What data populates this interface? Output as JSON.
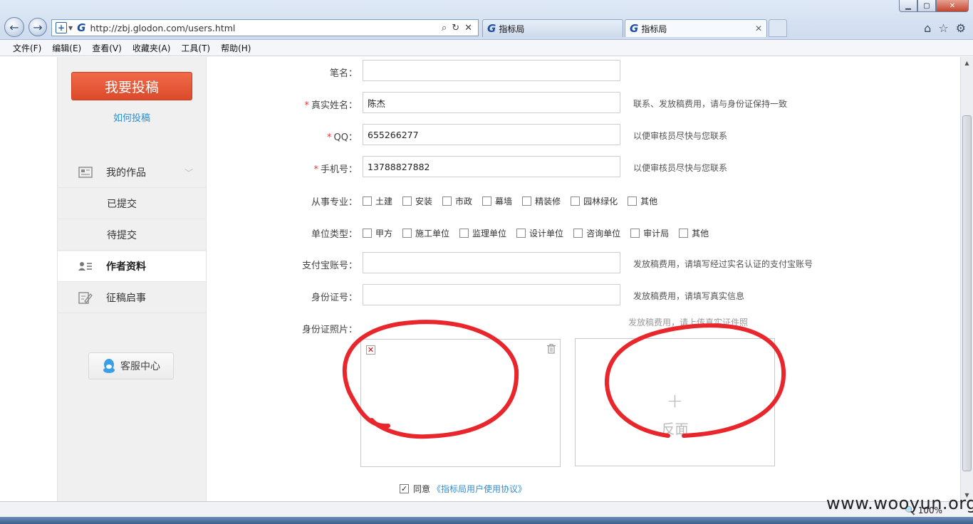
{
  "browser": {
    "url": "http://zbj.glodon.com/users.html",
    "tabs": [
      {
        "title": "指标局"
      },
      {
        "title": "指标局"
      }
    ],
    "menu": [
      "文件(F)",
      "编辑(E)",
      "查看(V)",
      "收藏夹(A)",
      "工具(T)",
      "帮助(H)"
    ],
    "zoom": "100%",
    "logo_letter": "G"
  },
  "sidebar": {
    "submit_button": "我要投稿",
    "howto_link": "如何投稿",
    "items": [
      {
        "label": "我的作品",
        "icon": "document-list-icon"
      },
      {
        "label": "已提交"
      },
      {
        "label": "待提交"
      },
      {
        "label": "作者资料",
        "icon": "profile-card-icon",
        "active": true
      },
      {
        "label": "征稿启事",
        "icon": "edit-note-icon"
      }
    ],
    "service_button": "客服中心"
  },
  "form": {
    "pen_name": {
      "label": "笔名：",
      "value": ""
    },
    "real_name": {
      "label": "真实姓名：",
      "value": "陈杰",
      "hint": "联系、发放稿费用，请与身份证保持一致",
      "required": true
    },
    "qq": {
      "label": "QQ：",
      "value": "655266277",
      "hint": "以便审核员尽快与您联系",
      "required": true
    },
    "phone": {
      "label": "手机号：",
      "value": "13788827882",
      "hint": "以便审核员尽快与您联系",
      "required": true
    },
    "profession": {
      "label": "从事专业：",
      "options": [
        "土建",
        "安装",
        "市政",
        "幕墙",
        "精装修",
        "园林绿化",
        "其他"
      ]
    },
    "unit_type": {
      "label": "单位类型：",
      "options": [
        "甲方",
        "施工单位",
        "监理单位",
        "设计单位",
        "咨询单位",
        "审计局",
        "其他"
      ]
    },
    "alipay": {
      "label": "支付宝账号：",
      "value": "",
      "hint": "发放稿费用，请填写经过实名认证的支付宝账号"
    },
    "id_number": {
      "label": "身份证号：",
      "value": "",
      "hint": "发放稿费用，请填写真实信息"
    },
    "id_photo": {
      "label": "身份证照片：",
      "hint": "发放稿费用，请上传真实证件照",
      "back_label": "反面",
      "plus": "+"
    },
    "agreement": {
      "check_mark": "✓",
      "agree": "同意",
      "link": "《指标局用户使用协议》",
      "checked": true
    },
    "required_mark": "*"
  },
  "watermark": "www.wooyun.org",
  "colors": {
    "accent_button": "#e8553a",
    "link": "#2d8fd1",
    "required": "#ee3333",
    "annotation": "#e8262b"
  }
}
